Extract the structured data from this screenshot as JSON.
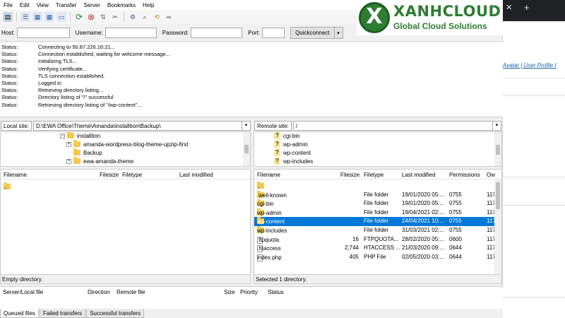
{
  "menu": [
    "File",
    "Edit",
    "View",
    "Transfer",
    "Server",
    "Bookmarks",
    "Help"
  ],
  "toolbar": {
    "icons": [
      "site-manager",
      "toggle-log",
      "toggle-local-tree",
      "toggle-remote-tree",
      "toggle-queue",
      "refresh",
      "cancel",
      "process-queue",
      "disconnect",
      "reconnect",
      "filter",
      "search-remote",
      "compare",
      "sync-browse"
    ]
  },
  "quickconnect": {
    "host_label": "Host:",
    "username_label": "Username:",
    "password_label": "Password:",
    "port_label": "Port:",
    "host_value": "",
    "username_value": "",
    "password_value": "",
    "port_value": "",
    "button_label": "Quickconnect",
    "dropdown_arrow": "▾"
  },
  "log": [
    {
      "k": "Status:",
      "v": "Connecting to 50.87.226.16:21..."
    },
    {
      "k": "Status:",
      "v": "Connection established, waiting for welcome message..."
    },
    {
      "k": "Status:",
      "v": "Initializing TLS..."
    },
    {
      "k": "Status:",
      "v": "Verifying certificate..."
    },
    {
      "k": "Status:",
      "v": "TLS connection established."
    },
    {
      "k": "Status:",
      "v": "Logged in"
    },
    {
      "k": "Status:",
      "v": "Retrieving directory listing..."
    },
    {
      "k": "Status:",
      "v": "Directory listing of \"/\" successful"
    },
    {
      "k": "Status:",
      "v": "Retrieving directory listing of \"/wp-content\"..."
    }
  ],
  "local": {
    "label": "Local site:",
    "path": "D:\\EWA Office\\Theme\\Amanda\\installtion\\Backup\\",
    "tree": [
      "installtion",
      "amanda-wordpress-blog-theme-upzip-first",
      "Backup",
      "ewa-amanda-theme"
    ],
    "columns": [
      "Filename",
      "Filesize",
      "Filetype",
      "Last modified"
    ],
    "rows": [
      ".."
    ],
    "status": "Empty directory."
  },
  "remote": {
    "label": "Remote site:",
    "path": "/",
    "tree": [
      "cgi-bin",
      "wp-admin",
      "wp-content",
      "wp-includes"
    ],
    "columns": [
      "Filename",
      "Filesize",
      "Filetype",
      "Last modified",
      "Permissions",
      "Ow"
    ],
    "rows": [
      {
        "name": "..",
        "size": "",
        "type": "",
        "modified": "",
        "perm": "",
        "owner": "",
        "icon": "folder"
      },
      {
        "name": ".well-known",
        "size": "",
        "type": "File folder",
        "modified": "19/01/2020 05:...",
        "perm": "0755",
        "owner": "117",
        "icon": "folder"
      },
      {
        "name": "cgi-bin",
        "size": "",
        "type": "File folder",
        "modified": "19/01/2020 05:...",
        "perm": "0755",
        "owner": "117",
        "icon": "folder"
      },
      {
        "name": "wp-admin",
        "size": "",
        "type": "File folder",
        "modified": "19/04/2021 02:...",
        "perm": "0755",
        "owner": "117",
        "icon": "folder"
      },
      {
        "name": "wp-content",
        "size": "",
        "type": "File folder",
        "modified": "24/04/2021 10:...",
        "perm": "0755",
        "owner": "117",
        "icon": "folder"
      },
      {
        "name": "wp-includes",
        "size": "",
        "type": "File folder",
        "modified": "31/03/2021 02:...",
        "perm": "0755",
        "owner": "117",
        "icon": "folder"
      },
      {
        "name": ".ftpquota",
        "size": "16",
        "type": "FTPQUOTA...",
        "modified": "28/02/2020 05:...",
        "perm": "0600",
        "owner": "117",
        "icon": "file"
      },
      {
        "name": ".htaccess",
        "size": "2,744",
        "type": "HTACCESS ...",
        "modified": "21/03/2020 09:...",
        "perm": "0644",
        "owner": "117",
        "icon": "file"
      },
      {
        "name": "index.php",
        "size": "405",
        "type": "PHP File",
        "modified": "02/05/2020 03:...",
        "perm": "0644",
        "owner": "117",
        "icon": "file"
      }
    ],
    "status": "Selected 1 directory."
  },
  "queue": {
    "columns": [
      "Server/Local file",
      "Direction",
      "Remote file",
      "Size",
      "Priority",
      "Status"
    ],
    "tabs": [
      "Queued files",
      "Failed transfers",
      "Successful transfers"
    ]
  },
  "browser": {
    "close_glyph": "✕",
    "new_tab_glyph": "+",
    "link_text": "Avatar | User Profile I"
  },
  "logo": {
    "letter": "X",
    "name": "XANHCLOUD",
    "tagline": "Global Cloud Solutions"
  },
  "colors": {
    "selection": "#0078d7",
    "brand": "#2e7d32"
  }
}
